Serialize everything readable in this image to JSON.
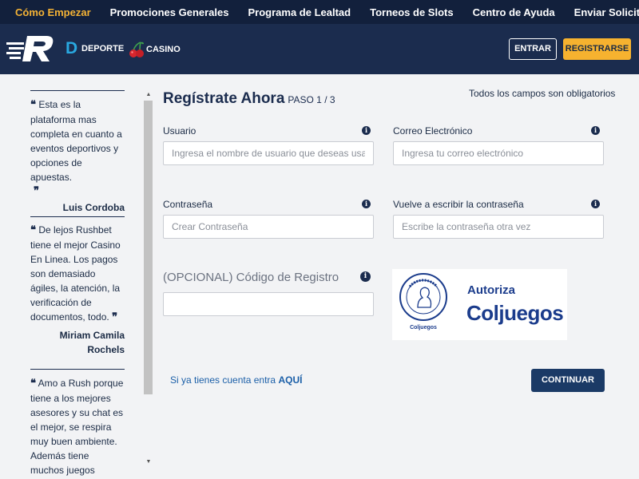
{
  "topnav": {
    "items": [
      "Cómo Empezar",
      "Promociones Generales",
      "Programa de Lealtad",
      "Torneos de Slots",
      "Centro de Ayuda",
      "Enviar Solicitud"
    ]
  },
  "header": {
    "deporte_label": "DEPORTE",
    "casino_label": "CASINO",
    "entrar_label": "ENTRAR",
    "registrarse_label": "REGISTRARSE"
  },
  "testimonials": [
    {
      "text": "Esta es la plataforma mas completa en cuanto a eventos deportivos y opciones de apuestas.",
      "author": "Luis Cordoba"
    },
    {
      "text": "De lejos Rushbet tiene el mejor Casino En Linea. Los pagos son demasiado ágiles, la atención, la verificación de documentos, todo.",
      "author": "Miriam Camila Rochels"
    },
    {
      "text": "Amo a Rush porque tiene a los mejores asesores y su chat es el mejor, se respira muy buen ambiente. Además tiene muchos juegos divertidos y las",
      "author": ""
    }
  ],
  "form": {
    "title": "Regístrate Ahora",
    "step": "PASO 1 / 3",
    "required_note": "Todos los campos son obligatorios",
    "usuario_label": "Usuario",
    "usuario_placeholder": "Ingresa el nombre de usuario que deseas usar",
    "correo_label": "Correo Electrónico",
    "correo_placeholder": "Ingresa tu correo electrónico",
    "password_label": "Contraseña",
    "password_placeholder": "Crear Contraseña",
    "password2_label": "Vuelve a escribir la contraseña",
    "password2_placeholder": "Escribe la contraseña otra vez",
    "codigo_label": "(OPCIONAL) Código de Registro",
    "codigo_value": "",
    "info_glyph": "i",
    "login_prefix": "Si ya tienes cuenta entra",
    "login_link": "AQUÍ",
    "continue_label": "CONTINUAR"
  },
  "coljuegos": {
    "autoriza": "Autoriza",
    "name": "Coljuegos",
    "seal_caption": "Coljuegos",
    "seal_ring": "Jugar legal es apostarle a la Salud"
  },
  "colors": {
    "topnav_bg": "#12203c",
    "header_bg": "#1b2c4e",
    "accent_yellow": "#f6b22f",
    "active_nav": "#f5b335",
    "primary_button": "#1b3a66",
    "link": "#1b5fa8"
  },
  "icons": {
    "logo": "rushbet-r-logo",
    "deporte": "deporte-d-icon",
    "casino": "cherry-icon",
    "info": "info-icon",
    "quote_open": "open-quote-icon",
    "quote_close": "close-quote-icon"
  }
}
